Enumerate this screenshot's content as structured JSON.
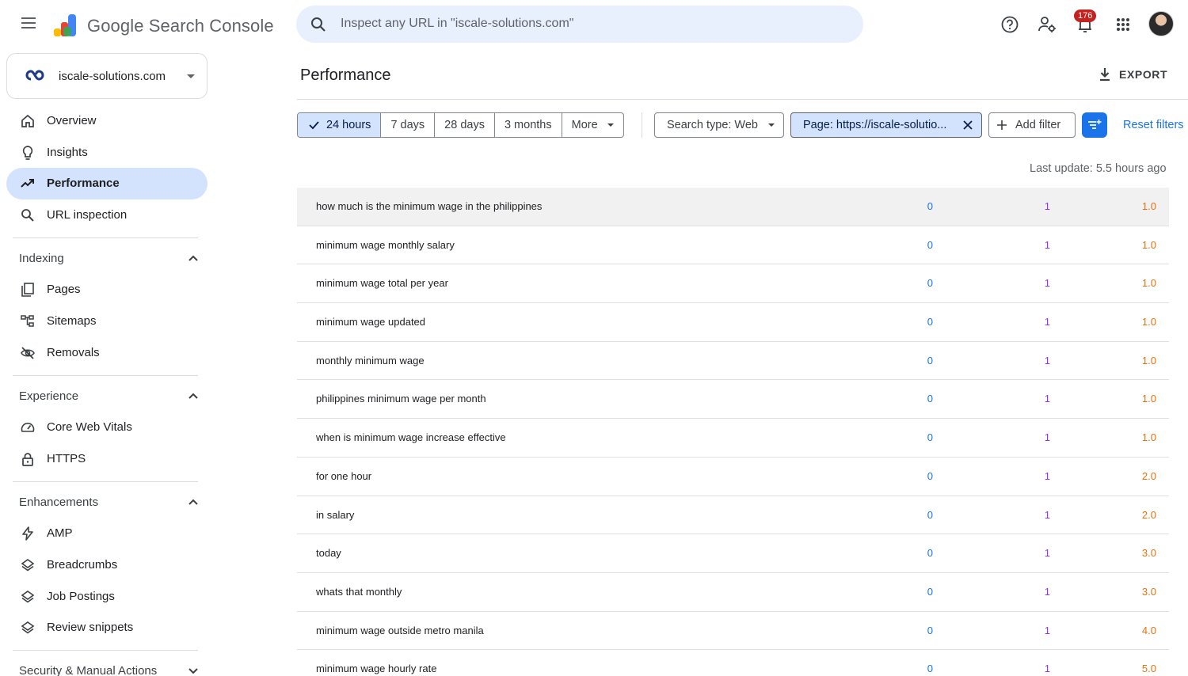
{
  "app": {
    "title": "Google Search Console",
    "search_placeholder": "Inspect any URL in \"iscale-solutions.com\"",
    "notification_count": "176"
  },
  "property": {
    "name": "iscale-solutions.com"
  },
  "sidebar": {
    "top_items": [
      {
        "label": "Overview",
        "icon": "home-icon"
      },
      {
        "label": "Insights",
        "icon": "lightbulb-icon"
      },
      {
        "label": "Performance",
        "icon": "trending-up-icon",
        "active": true
      },
      {
        "label": "URL inspection",
        "icon": "search-icon"
      }
    ],
    "sections": [
      {
        "title": "Indexing",
        "expanded": true,
        "items": [
          {
            "label": "Pages",
            "icon": "pages-icon"
          },
          {
            "label": "Sitemaps",
            "icon": "sitemap-icon"
          },
          {
            "label": "Removals",
            "icon": "visibility-off-icon"
          }
        ]
      },
      {
        "title": "Experience",
        "expanded": true,
        "items": [
          {
            "label": "Core Web Vitals",
            "icon": "speed-icon"
          },
          {
            "label": "HTTPS",
            "icon": "lock-icon"
          }
        ]
      },
      {
        "title": "Enhancements",
        "expanded": true,
        "items": [
          {
            "label": "AMP",
            "icon": "bolt-icon"
          },
          {
            "label": "Breadcrumbs",
            "icon": "layers-icon"
          },
          {
            "label": "Job Postings",
            "icon": "layers-icon"
          },
          {
            "label": "Review snippets",
            "icon": "layers-icon"
          }
        ]
      },
      {
        "title": "Security & Manual Actions",
        "expanded": false,
        "items": []
      }
    ]
  },
  "main": {
    "title": "Performance",
    "export_label": "EXPORT",
    "date_ranges": [
      "24 hours",
      "7 days",
      "28 days",
      "3 months",
      "More"
    ],
    "selected_range": "24 hours",
    "search_type_chip": "Search type: Web",
    "page_chip": "Page: https://iscale-solutio...",
    "add_filter_label": "Add filter",
    "reset_label": "Reset filters",
    "last_update": "Last update: 5.5 hours ago"
  },
  "colors": {
    "clicks": "#1a73e8",
    "impressions": "#9334e6",
    "position": "#e8710a",
    "accent": "#1a73e8"
  },
  "table": {
    "rows": [
      {
        "query": "how much is the minimum wage in the philippines",
        "clicks": "0",
        "impressions": "1",
        "position": "1.0"
      },
      {
        "query": "minimum wage monthly salary",
        "clicks": "0",
        "impressions": "1",
        "position": "1.0"
      },
      {
        "query": "minimum wage total per year",
        "clicks": "0",
        "impressions": "1",
        "position": "1.0"
      },
      {
        "query": "minimum wage updated",
        "clicks": "0",
        "impressions": "1",
        "position": "1.0"
      },
      {
        "query": "monthly minimum wage",
        "clicks": "0",
        "impressions": "1",
        "position": "1.0"
      },
      {
        "query": "philippines minimum wage per month",
        "clicks": "0",
        "impressions": "1",
        "position": "1.0"
      },
      {
        "query": "when is minimum wage increase effective",
        "clicks": "0",
        "impressions": "1",
        "position": "1.0"
      },
      {
        "query": "for one hour",
        "clicks": "0",
        "impressions": "1",
        "position": "2.0"
      },
      {
        "query": "in salary",
        "clicks": "0",
        "impressions": "1",
        "position": "2.0"
      },
      {
        "query": "today",
        "clicks": "0",
        "impressions": "1",
        "position": "3.0"
      },
      {
        "query": "whats that monthly",
        "clicks": "0",
        "impressions": "1",
        "position": "3.0"
      },
      {
        "query": "minimum wage outside metro manila",
        "clicks": "0",
        "impressions": "1",
        "position": "4.0"
      },
      {
        "query": "minimum wage hourly rate",
        "clicks": "0",
        "impressions": "1",
        "position": "5.0"
      }
    ]
  }
}
